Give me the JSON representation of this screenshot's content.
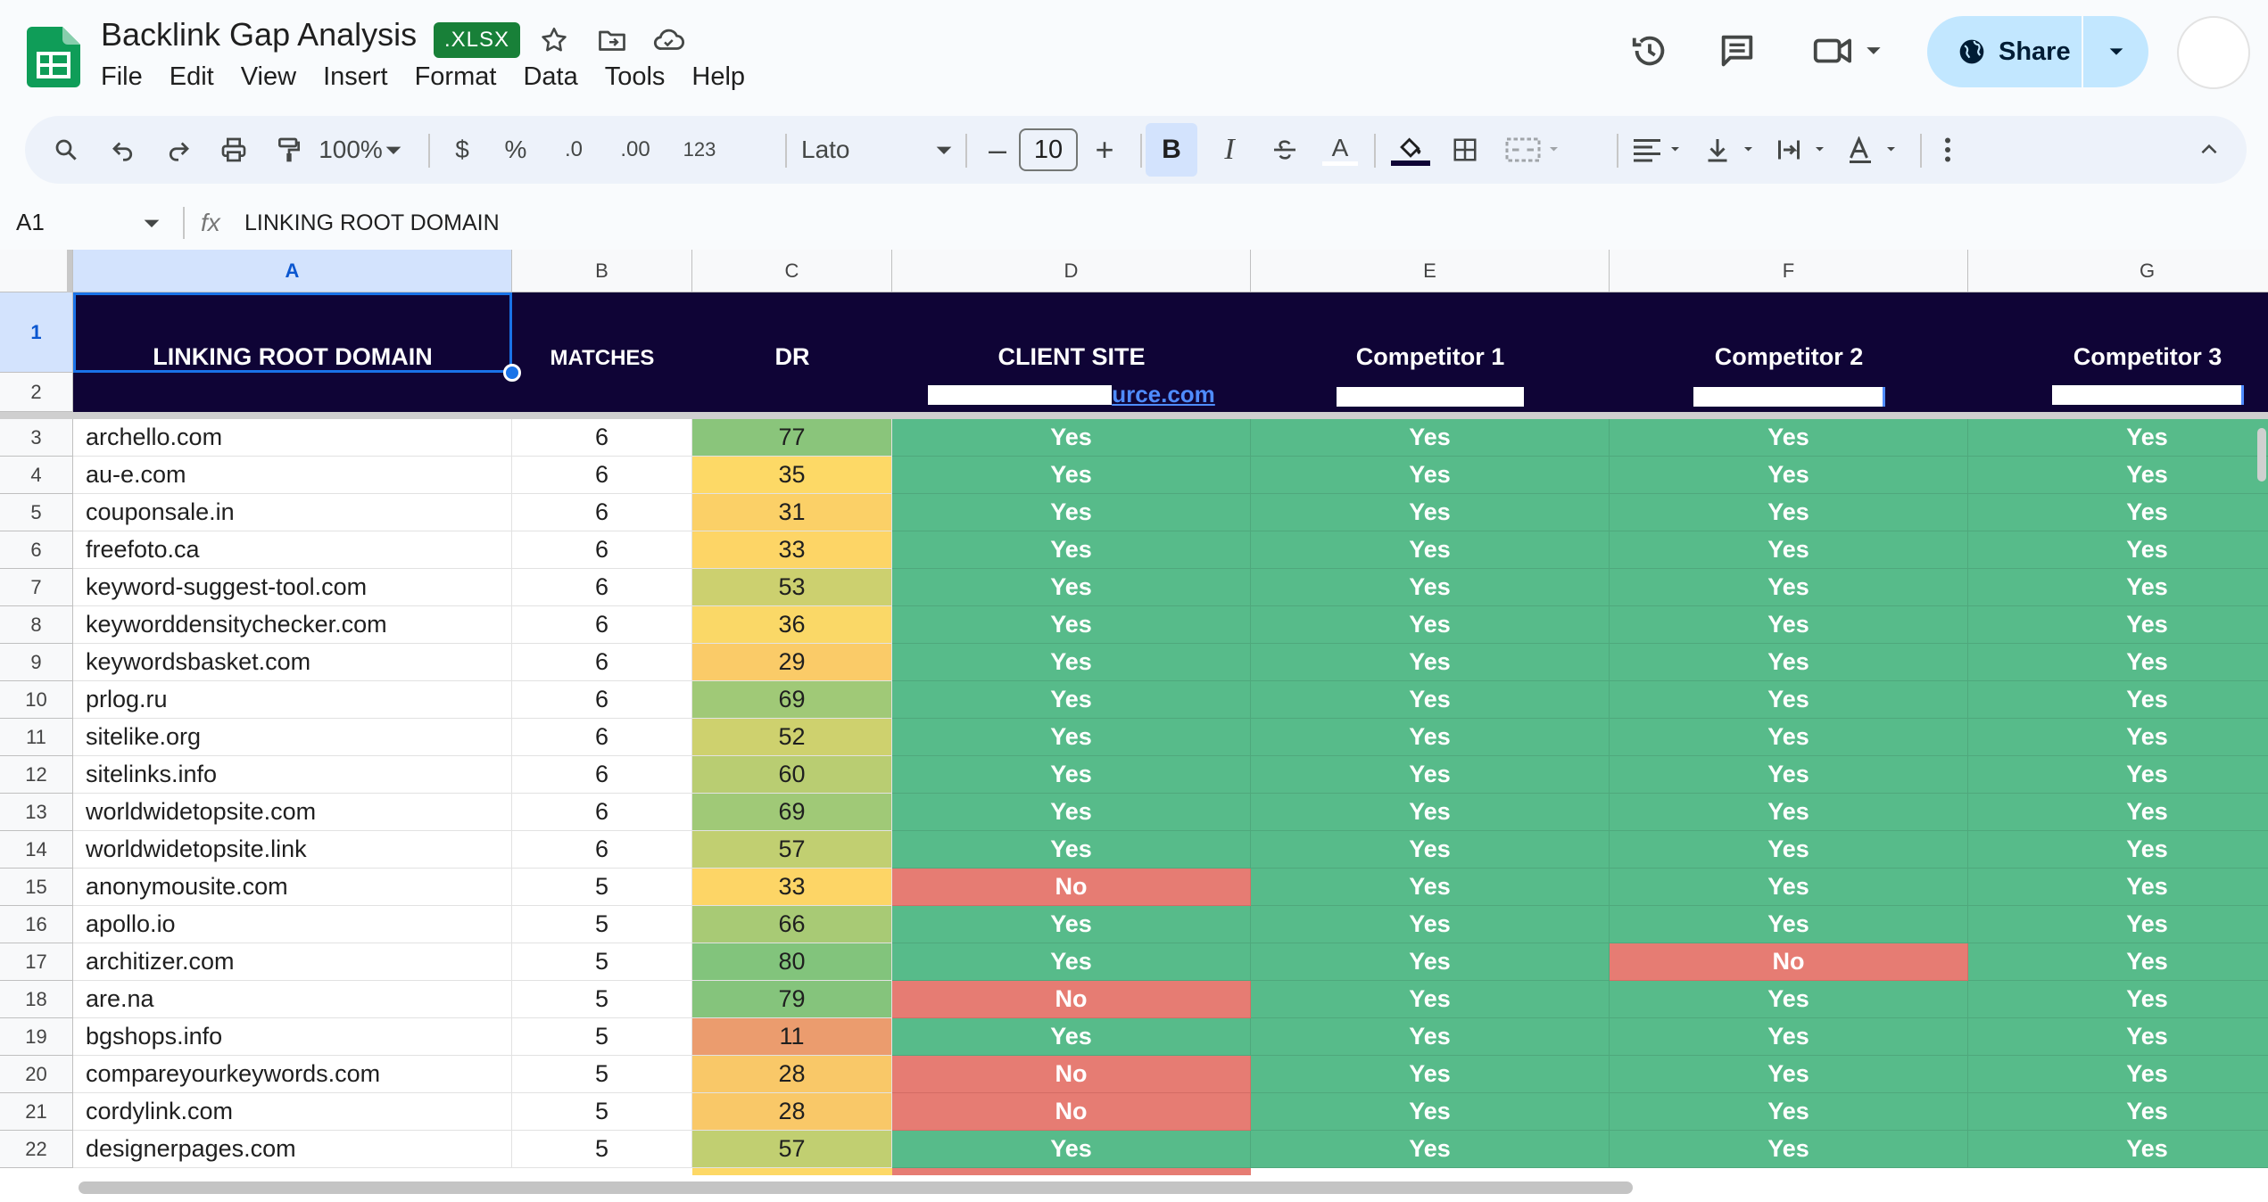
{
  "doc": {
    "title": "Backlink Gap Analysis",
    "badge": ".XLSX"
  },
  "menu": [
    "File",
    "Edit",
    "View",
    "Insert",
    "Format",
    "Data",
    "Tools",
    "Help"
  ],
  "share": {
    "label": "Share"
  },
  "toolbar": {
    "zoom": "100%",
    "currency": "$",
    "percent": "%",
    "decrease_decimal": ".0",
    "increase_decimal": ".00",
    "number_format": "123",
    "font": "Lato",
    "font_size": "10",
    "minus": "–",
    "plus": "+",
    "bold": "B",
    "italic": "I",
    "text_color": "A"
  },
  "formula_bar": {
    "cell_ref": "A1",
    "fx": "fx",
    "content": "LINKING ROOT DOMAIN"
  },
  "columns": [
    "A",
    "B",
    "C",
    "D",
    "E",
    "F",
    "G"
  ],
  "header": {
    "domain": "LINKING ROOT DOMAIN",
    "matches": "MATCHES",
    "dr": "DR",
    "client": "CLIENT SITE",
    "comp1": "Competitor 1",
    "comp2": "Competitor 2",
    "comp3": "Competitor 3",
    "client_url_visible": "urce.com"
  },
  "rows": [
    {
      "n": "3",
      "domain": "archello.com",
      "matches": "6",
      "dr": "77",
      "d": "Yes",
      "e": "Yes",
      "f": "Yes",
      "g": "Yes"
    },
    {
      "n": "4",
      "domain": "au-e.com",
      "matches": "6",
      "dr": "35",
      "d": "Yes",
      "e": "Yes",
      "f": "Yes",
      "g": "Yes"
    },
    {
      "n": "5",
      "domain": "couponsale.in",
      "matches": "6",
      "dr": "31",
      "d": "Yes",
      "e": "Yes",
      "f": "Yes",
      "g": "Yes"
    },
    {
      "n": "6",
      "domain": "freefoto.ca",
      "matches": "6",
      "dr": "33",
      "d": "Yes",
      "e": "Yes",
      "f": "Yes",
      "g": "Yes"
    },
    {
      "n": "7",
      "domain": "keyword-suggest-tool.com",
      "matches": "6",
      "dr": "53",
      "d": "Yes",
      "e": "Yes",
      "f": "Yes",
      "g": "Yes"
    },
    {
      "n": "8",
      "domain": "keyworddensitychecker.com",
      "matches": "6",
      "dr": "36",
      "d": "Yes",
      "e": "Yes",
      "f": "Yes",
      "g": "Yes"
    },
    {
      "n": "9",
      "domain": "keywordsbasket.com",
      "matches": "6",
      "dr": "29",
      "d": "Yes",
      "e": "Yes",
      "f": "Yes",
      "g": "Yes"
    },
    {
      "n": "10",
      "domain": "prlog.ru",
      "matches": "6",
      "dr": "69",
      "d": "Yes",
      "e": "Yes",
      "f": "Yes",
      "g": "Yes"
    },
    {
      "n": "11",
      "domain": "sitelike.org",
      "matches": "6",
      "dr": "52",
      "d": "Yes",
      "e": "Yes",
      "f": "Yes",
      "g": "Yes"
    },
    {
      "n": "12",
      "domain": "sitelinks.info",
      "matches": "6",
      "dr": "60",
      "d": "Yes",
      "e": "Yes",
      "f": "Yes",
      "g": "Yes"
    },
    {
      "n": "13",
      "domain": "worldwidetopsite.com",
      "matches": "6",
      "dr": "69",
      "d": "Yes",
      "e": "Yes",
      "f": "Yes",
      "g": "Yes"
    },
    {
      "n": "14",
      "domain": "worldwidetopsite.link",
      "matches": "6",
      "dr": "57",
      "d": "Yes",
      "e": "Yes",
      "f": "Yes",
      "g": "Yes"
    },
    {
      "n": "15",
      "domain": "anonymousite.com",
      "matches": "5",
      "dr": "33",
      "d": "No",
      "e": "Yes",
      "f": "Yes",
      "g": "Yes"
    },
    {
      "n": "16",
      "domain": "apollo.io",
      "matches": "5",
      "dr": "66",
      "d": "Yes",
      "e": "Yes",
      "f": "Yes",
      "g": "Yes"
    },
    {
      "n": "17",
      "domain": "architizer.com",
      "matches": "5",
      "dr": "80",
      "d": "Yes",
      "e": "Yes",
      "f": "No",
      "g": "Yes"
    },
    {
      "n": "18",
      "domain": "are.na",
      "matches": "5",
      "dr": "79",
      "d": "No",
      "e": "Yes",
      "f": "Yes",
      "g": "Yes"
    },
    {
      "n": "19",
      "domain": "bgshops.info",
      "matches": "5",
      "dr": "11",
      "d": "Yes",
      "e": "Yes",
      "f": "Yes",
      "g": "Yes"
    },
    {
      "n": "20",
      "domain": "compareyourkeywords.com",
      "matches": "5",
      "dr": "28",
      "d": "No",
      "e": "Yes",
      "f": "Yes",
      "g": "Yes"
    },
    {
      "n": "21",
      "domain": "cordylink.com",
      "matches": "5",
      "dr": "28",
      "d": "No",
      "e": "Yes",
      "f": "Yes",
      "g": "Yes"
    },
    {
      "n": "22",
      "domain": "designerpages.com",
      "matches": "5",
      "dr": "57",
      "d": "Yes",
      "e": "Yes",
      "f": "Yes",
      "g": "Yes"
    }
  ],
  "colors": {
    "header_bg": "#0f0436",
    "yes": "#57bb8a",
    "no": "#e67c73",
    "selection": "#1a73e8"
  }
}
